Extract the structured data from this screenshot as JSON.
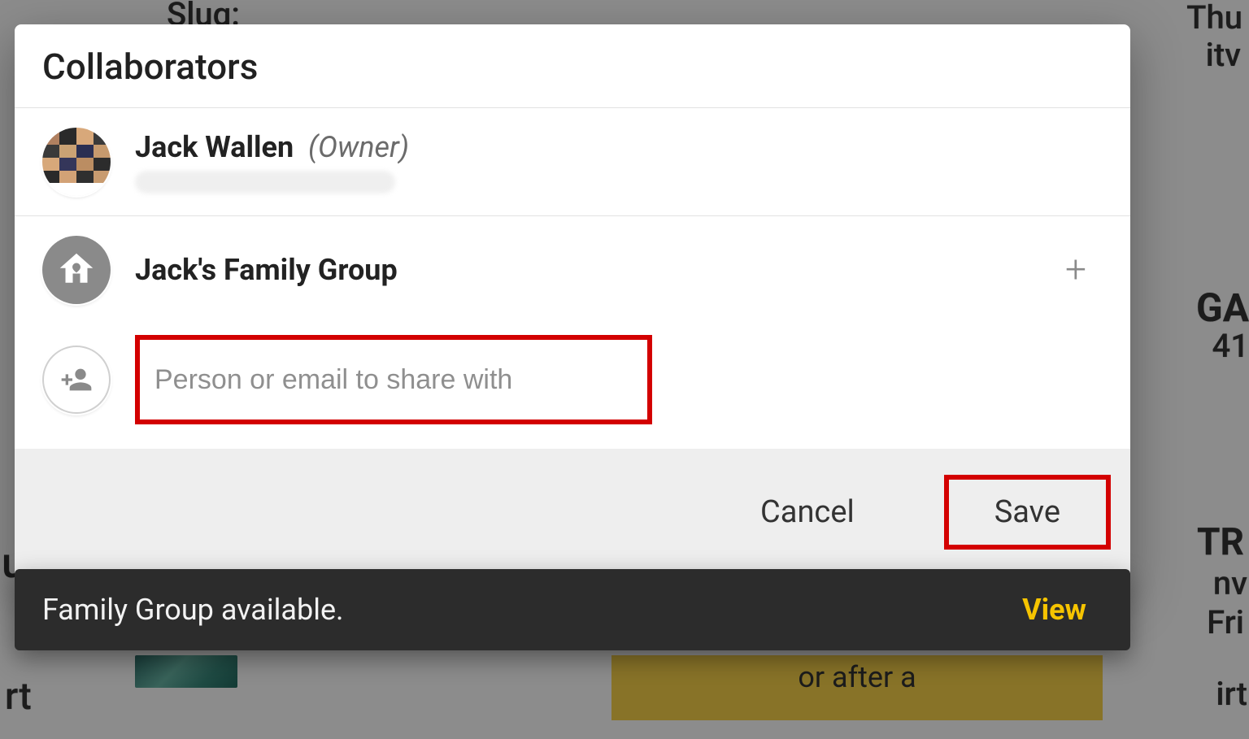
{
  "background": {
    "slug_label": "Slug:",
    "right_fragments": [
      "Thu",
      "itv",
      "GA",
      "41",
      "TR",
      "nv",
      "Fri",
      "irt"
    ],
    "left_fragments": [
      "u",
      "rt"
    ],
    "yellow_text": "or after a"
  },
  "modal": {
    "title": "Collaborators",
    "owner": {
      "name": "Jack Wallen",
      "role": "(Owner)"
    },
    "group": {
      "name": "Jack's Family Group"
    },
    "share_placeholder": "Person or email to share with",
    "add_symbol": "+",
    "actions": {
      "cancel": "Cancel",
      "save": "Save"
    }
  },
  "toast": {
    "message": "Family Group available.",
    "action": "View"
  }
}
